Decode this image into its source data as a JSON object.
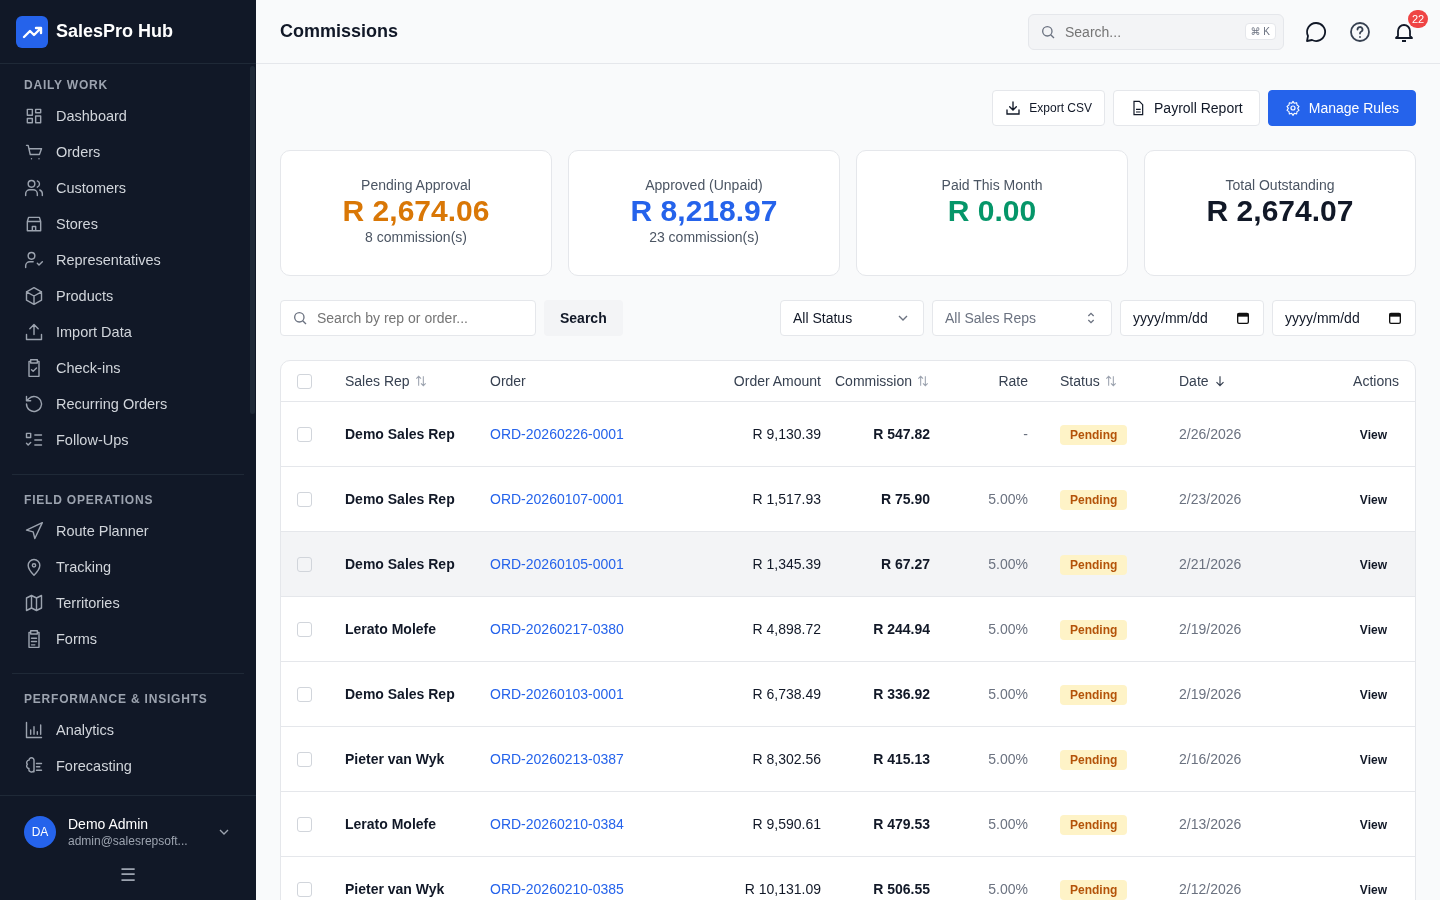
{
  "brand": {
    "name": "SalesPro Hub"
  },
  "sidebar": {
    "sections": [
      {
        "title": "DAILY WORK",
        "items": [
          {
            "label": "Dashboard"
          },
          {
            "label": "Orders"
          },
          {
            "label": "Customers"
          },
          {
            "label": "Stores"
          },
          {
            "label": "Representatives"
          },
          {
            "label": "Products"
          },
          {
            "label": "Import Data"
          },
          {
            "label": "Check-ins"
          },
          {
            "label": "Recurring Orders"
          },
          {
            "label": "Follow-Ups"
          }
        ]
      },
      {
        "title": "FIELD OPERATIONS",
        "items": [
          {
            "label": "Route Planner"
          },
          {
            "label": "Tracking"
          },
          {
            "label": "Territories"
          },
          {
            "label": "Forms"
          }
        ]
      },
      {
        "title": "PERFORMANCE & INSIGHTS",
        "items": [
          {
            "label": "Analytics"
          },
          {
            "label": "Forecasting"
          }
        ]
      }
    ],
    "user": {
      "initials": "DA",
      "name": "Demo Admin",
      "email": "admin@salesrepsoft..."
    },
    "menu_glyph": "☰"
  },
  "header": {
    "title": "Commissions",
    "search": {
      "placeholder": "Search...",
      "shortcut": "⌘ K"
    },
    "notifications": "22"
  },
  "actions": [
    {
      "label": "Export CSV",
      "kind": "download"
    },
    {
      "label": "Payroll Report",
      "kind": "report"
    },
    {
      "label": "Manage Rules",
      "kind": "primary"
    }
  ],
  "stats": [
    {
      "label": "Pending Approval",
      "value": "R 2,674.06",
      "sub": "8 commission(s)",
      "color": "#d97706"
    },
    {
      "label": "Approved (Unpaid)",
      "value": "R 8,218.97",
      "sub": "23 commission(s)",
      "color": "#2563eb"
    },
    {
      "label": "Paid This Month",
      "value": "R 0.00",
      "color": "#059669"
    },
    {
      "label": "Total Outstanding",
      "value": "R 2,674.07",
      "color": "#111827"
    }
  ],
  "filters": {
    "search": {
      "placeholder": "Search by rep or order..."
    },
    "search_button": "Search",
    "status": "All Status",
    "reps": "All Sales Reps",
    "date_from": "yyyy/mm/dd",
    "date_to": "yyyy/mm/dd"
  },
  "table": {
    "all_selected": false,
    "columns": [
      {
        "label": "Sales Rep",
        "kind": "sortable"
      },
      {
        "label": "Order",
        "kind": "plain"
      },
      {
        "label": "Order Amount",
        "kind": "plain"
      },
      {
        "label": "Commission",
        "kind": "sortable"
      },
      {
        "label": "Rate",
        "kind": "plain"
      },
      {
        "label": "Status",
        "kind": "sortable"
      },
      {
        "label": "Date",
        "kind": "sorted"
      },
      {
        "label": "Actions",
        "kind": "plain"
      }
    ],
    "rows": [
      {
        "rep": "Demo Sales Rep",
        "order": "ORD-20260226-0001",
        "amount": "R 9,130.39",
        "commission": "R 547.82",
        "rate": "-",
        "status": "Pending",
        "date": "2/26/2026",
        "action": "View",
        "checked": false,
        "hovered": false
      },
      {
        "rep": "Demo Sales Rep",
        "order": "ORD-20260107-0001",
        "amount": "R 1,517.93",
        "commission": "R 75.90",
        "rate": "5.00%",
        "status": "Pending",
        "date": "2/23/2026",
        "action": "View",
        "checked": false,
        "hovered": false
      },
      {
        "rep": "Demo Sales Rep",
        "order": "ORD-20260105-0001",
        "amount": "R 1,345.39",
        "commission": "R 67.27",
        "rate": "5.00%",
        "status": "Pending",
        "date": "2/21/2026",
        "action": "View",
        "checked": false,
        "hovered": true
      },
      {
        "rep": "Lerato Molefe",
        "order": "ORD-20260217-0380",
        "amount": "R 4,898.72",
        "commission": "R 244.94",
        "rate": "5.00%",
        "status": "Pending",
        "date": "2/19/2026",
        "action": "View",
        "checked": false,
        "hovered": false
      },
      {
        "rep": "Demo Sales Rep",
        "order": "ORD-20260103-0001",
        "amount": "R 6,738.49",
        "commission": "R 336.92",
        "rate": "5.00%",
        "status": "Pending",
        "date": "2/19/2026",
        "action": "View",
        "checked": false,
        "hovered": false
      },
      {
        "rep": "Pieter van Wyk",
        "order": "ORD-20260213-0387",
        "amount": "R 8,302.56",
        "commission": "R 415.13",
        "rate": "5.00%",
        "status": "Pending",
        "date": "2/16/2026",
        "action": "View",
        "checked": false,
        "hovered": false
      },
      {
        "rep": "Lerato Molefe",
        "order": "ORD-20260210-0384",
        "amount": "R 9,590.61",
        "commission": "R 479.53",
        "rate": "5.00%",
        "status": "Pending",
        "date": "2/13/2026",
        "action": "View",
        "checked": false,
        "hovered": false
      },
      {
        "rep": "Pieter van Wyk",
        "order": "ORD-20260210-0385",
        "amount": "R 10,131.09",
        "commission": "R 506.55",
        "rate": "5.00%",
        "status": "Pending",
        "date": "2/12/2026",
        "action": "View",
        "checked": false,
        "hovered": false
      }
    ]
  }
}
